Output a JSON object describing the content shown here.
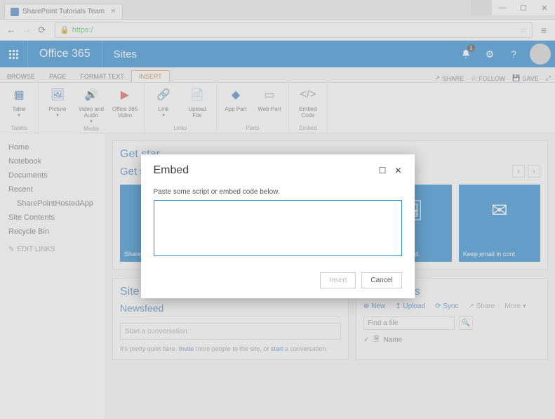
{
  "browser": {
    "tab_title": "SharePoint Tutorials Team",
    "url_prefix": "https:/",
    "window": {
      "minimize": "—",
      "maximize": "☐",
      "close": "✕"
    }
  },
  "suitebar": {
    "brand": "Office 365",
    "app": "Sites",
    "notif_count": "1",
    "gear": "⚙",
    "help": "?"
  },
  "ribbon_tabs": {
    "browse": "BROWSE",
    "page": "PAGE",
    "format": "FORMAT TEXT",
    "insert": "INSERT",
    "share": "SHARE",
    "follow": "FOLLOW",
    "save": "SAVE"
  },
  "ribbon": {
    "groups": {
      "tables": {
        "label": "Tables",
        "items": {
          "table": "Table"
        }
      },
      "media": {
        "label": "Media",
        "items": {
          "picture": "Picture",
          "video_audio": "Video and Audio",
          "o365_video": "Office 365 Video"
        }
      },
      "links": {
        "label": "Links",
        "items": {
          "link": "Link",
          "upload_file": "Upload File"
        }
      },
      "parts": {
        "label": "Parts",
        "items": {
          "app_part": "App Part",
          "web_part": "Web Part"
        }
      },
      "embed": {
        "label": "Embed",
        "items": {
          "embed_code": "Embed Code"
        }
      }
    }
  },
  "leftnav": {
    "home": "Home",
    "notebook": "Notebook",
    "documents": "Documents",
    "recent": "Recent",
    "sp_app": "SharePointHostedApp",
    "site_contents": "Site Contents",
    "recycle": "Recycle Bin",
    "edit_links": "EDIT LINKS"
  },
  "getstarted": {
    "title": "Get star",
    "subtitle": "Get star",
    "tiles": {
      "share": "Share yo",
      "site_brand": "site. Your brand.",
      "email": "Keep email in cont"
    }
  },
  "sitefeed": {
    "title": "Site Feed",
    "newsfeed": "Newsfeed",
    "placeholder": "Start a conversation",
    "quiet_pre": "It's pretty quiet here. ",
    "invite": "Invite",
    "quiet_mid": " more people to the site, or ",
    "start": "start",
    "quiet_post": " a conversation."
  },
  "documents": {
    "title": "Documents",
    "new": "New",
    "upload": "Upload",
    "sync": "Sync",
    "share": "Share",
    "more": "More",
    "find_placeholder": "Find a file",
    "col_name": "Name"
  },
  "modal": {
    "title": "Embed",
    "instruction": "Paste some script or embed code below.",
    "insert": "Insert",
    "cancel": "Cancel",
    "maximize": "☐",
    "close": "✕"
  }
}
